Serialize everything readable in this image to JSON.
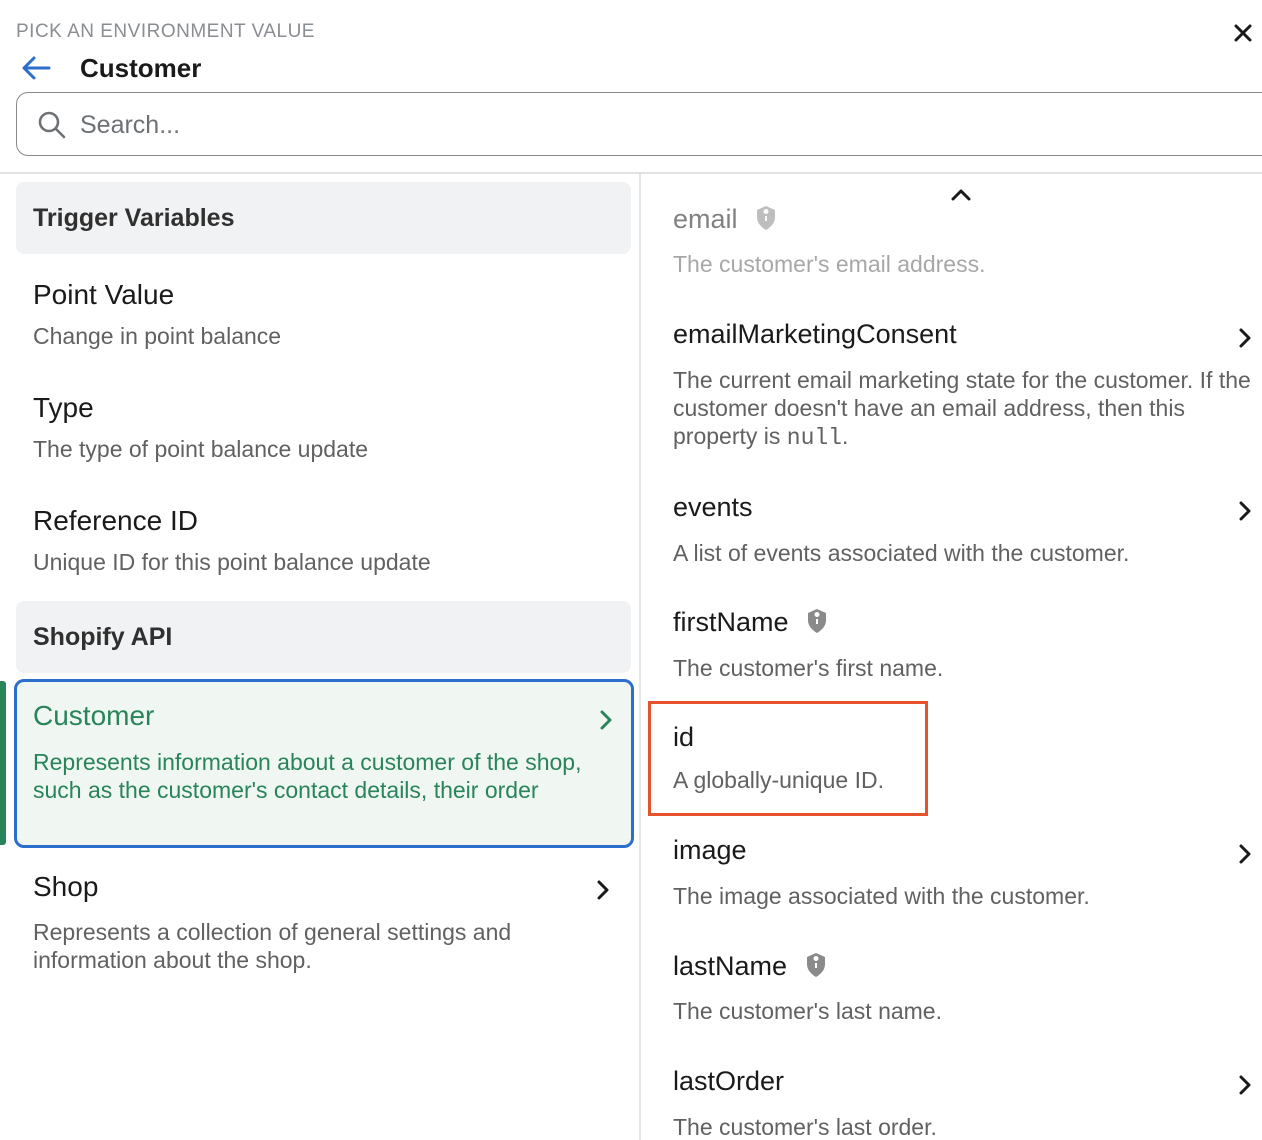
{
  "header": {
    "eyebrow": "PICK AN ENVIRONMENT VALUE",
    "title": "Customer",
    "search_placeholder": "Search..."
  },
  "left": {
    "sections": [
      {
        "header": "Trigger Variables",
        "items": [
          {
            "title": "Point Value",
            "desc": "Change in point balance"
          },
          {
            "title": "Type",
            "desc": "The type of point balance update"
          },
          {
            "title": "Reference ID",
            "desc": "Unique ID for this point balance update"
          }
        ]
      },
      {
        "header": "Shopify API",
        "items": [
          {
            "title": "Customer",
            "desc": "Represents information about a customer of the shop, such as the customer's contact details, their order",
            "selected": true
          },
          {
            "title": "Shop",
            "desc": "Represents a collection of general settings and information about the shop."
          }
        ]
      }
    ]
  },
  "right": {
    "items": [
      {
        "title": "email",
        "desc": "The customer's email address.",
        "protected": true
      },
      {
        "title": "emailMarketingConsent",
        "desc_start": "The current email marketing state for the customer. If the customer doesn't have an email address, then this property is ",
        "desc_code": "null",
        "desc_end": ".",
        "has_children": true
      },
      {
        "title": "events",
        "desc": "A list of events associated with the customer.",
        "has_children": true
      },
      {
        "title": "firstName",
        "desc": "The customer's first name.",
        "protected": true
      },
      {
        "title": "id",
        "desc": "A globally-unique ID.",
        "highlighted": true
      },
      {
        "title": "image",
        "desc": "The image associated with the customer.",
        "has_children": true
      },
      {
        "title": "lastName",
        "desc": "The customer's last name.",
        "protected": true
      },
      {
        "title": "lastOrder",
        "desc": "The customer's last order.",
        "has_children": true
      }
    ]
  },
  "colors": {
    "accent_blue": "#2c6ecb",
    "selected_green": "#29845a",
    "selected_bg": "#f0f7f3",
    "highlight_red": "#e5532d"
  }
}
